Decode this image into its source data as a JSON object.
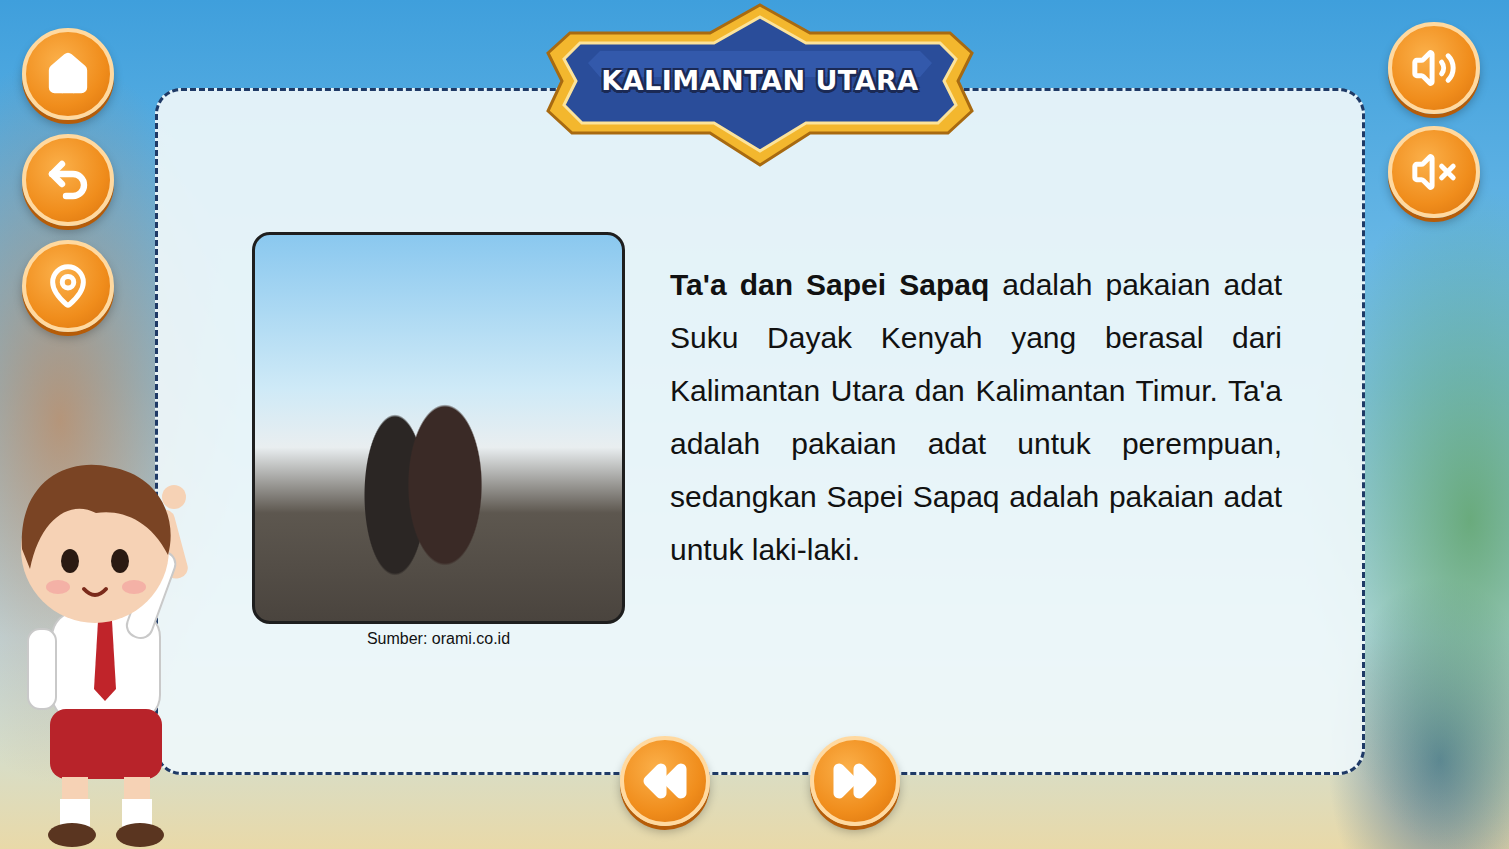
{
  "header": {
    "title": "KALIMANTAN UTARA"
  },
  "article": {
    "term": "Ta'a dan Sapei Sapaq",
    "body": " adalah pakaian adat Suku Dayak Kenyah yang berasal dari Kalimantan Utara dan Kalimantan Timur. Ta'a adalah pakaian adat untuk perempuan, sedangkan Sapei Sapaq adalah pakaian adat untuk laki-laki."
  },
  "photo": {
    "caption": "Sumber: orami.co.id"
  }
}
